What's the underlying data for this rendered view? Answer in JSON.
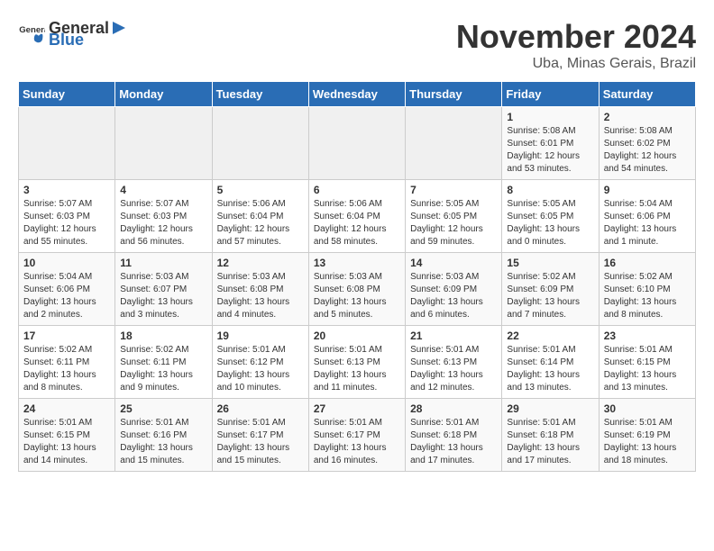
{
  "header": {
    "logo_general": "General",
    "logo_blue": "Blue",
    "month_title": "November 2024",
    "subtitle": "Uba, Minas Gerais, Brazil"
  },
  "weekdays": [
    "Sunday",
    "Monday",
    "Tuesday",
    "Wednesday",
    "Thursday",
    "Friday",
    "Saturday"
  ],
  "weeks": [
    [
      {
        "day": "",
        "info": ""
      },
      {
        "day": "",
        "info": ""
      },
      {
        "day": "",
        "info": ""
      },
      {
        "day": "",
        "info": ""
      },
      {
        "day": "",
        "info": ""
      },
      {
        "day": "1",
        "info": "Sunrise: 5:08 AM\nSunset: 6:01 PM\nDaylight: 12 hours and 53 minutes."
      },
      {
        "day": "2",
        "info": "Sunrise: 5:08 AM\nSunset: 6:02 PM\nDaylight: 12 hours and 54 minutes."
      }
    ],
    [
      {
        "day": "3",
        "info": "Sunrise: 5:07 AM\nSunset: 6:03 PM\nDaylight: 12 hours and 55 minutes."
      },
      {
        "day": "4",
        "info": "Sunrise: 5:07 AM\nSunset: 6:03 PM\nDaylight: 12 hours and 56 minutes."
      },
      {
        "day": "5",
        "info": "Sunrise: 5:06 AM\nSunset: 6:04 PM\nDaylight: 12 hours and 57 minutes."
      },
      {
        "day": "6",
        "info": "Sunrise: 5:06 AM\nSunset: 6:04 PM\nDaylight: 12 hours and 58 minutes."
      },
      {
        "day": "7",
        "info": "Sunrise: 5:05 AM\nSunset: 6:05 PM\nDaylight: 12 hours and 59 minutes."
      },
      {
        "day": "8",
        "info": "Sunrise: 5:05 AM\nSunset: 6:05 PM\nDaylight: 13 hours and 0 minutes."
      },
      {
        "day": "9",
        "info": "Sunrise: 5:04 AM\nSunset: 6:06 PM\nDaylight: 13 hours and 1 minute."
      }
    ],
    [
      {
        "day": "10",
        "info": "Sunrise: 5:04 AM\nSunset: 6:06 PM\nDaylight: 13 hours and 2 minutes."
      },
      {
        "day": "11",
        "info": "Sunrise: 5:03 AM\nSunset: 6:07 PM\nDaylight: 13 hours and 3 minutes."
      },
      {
        "day": "12",
        "info": "Sunrise: 5:03 AM\nSunset: 6:08 PM\nDaylight: 13 hours and 4 minutes."
      },
      {
        "day": "13",
        "info": "Sunrise: 5:03 AM\nSunset: 6:08 PM\nDaylight: 13 hours and 5 minutes."
      },
      {
        "day": "14",
        "info": "Sunrise: 5:03 AM\nSunset: 6:09 PM\nDaylight: 13 hours and 6 minutes."
      },
      {
        "day": "15",
        "info": "Sunrise: 5:02 AM\nSunset: 6:09 PM\nDaylight: 13 hours and 7 minutes."
      },
      {
        "day": "16",
        "info": "Sunrise: 5:02 AM\nSunset: 6:10 PM\nDaylight: 13 hours and 8 minutes."
      }
    ],
    [
      {
        "day": "17",
        "info": "Sunrise: 5:02 AM\nSunset: 6:11 PM\nDaylight: 13 hours and 8 minutes."
      },
      {
        "day": "18",
        "info": "Sunrise: 5:02 AM\nSunset: 6:11 PM\nDaylight: 13 hours and 9 minutes."
      },
      {
        "day": "19",
        "info": "Sunrise: 5:01 AM\nSunset: 6:12 PM\nDaylight: 13 hours and 10 minutes."
      },
      {
        "day": "20",
        "info": "Sunrise: 5:01 AM\nSunset: 6:13 PM\nDaylight: 13 hours and 11 minutes."
      },
      {
        "day": "21",
        "info": "Sunrise: 5:01 AM\nSunset: 6:13 PM\nDaylight: 13 hours and 12 minutes."
      },
      {
        "day": "22",
        "info": "Sunrise: 5:01 AM\nSunset: 6:14 PM\nDaylight: 13 hours and 13 minutes."
      },
      {
        "day": "23",
        "info": "Sunrise: 5:01 AM\nSunset: 6:15 PM\nDaylight: 13 hours and 13 minutes."
      }
    ],
    [
      {
        "day": "24",
        "info": "Sunrise: 5:01 AM\nSunset: 6:15 PM\nDaylight: 13 hours and 14 minutes."
      },
      {
        "day": "25",
        "info": "Sunrise: 5:01 AM\nSunset: 6:16 PM\nDaylight: 13 hours and 15 minutes."
      },
      {
        "day": "26",
        "info": "Sunrise: 5:01 AM\nSunset: 6:17 PM\nDaylight: 13 hours and 15 minutes."
      },
      {
        "day": "27",
        "info": "Sunrise: 5:01 AM\nSunset: 6:17 PM\nDaylight: 13 hours and 16 minutes."
      },
      {
        "day": "28",
        "info": "Sunrise: 5:01 AM\nSunset: 6:18 PM\nDaylight: 13 hours and 17 minutes."
      },
      {
        "day": "29",
        "info": "Sunrise: 5:01 AM\nSunset: 6:18 PM\nDaylight: 13 hours and 17 minutes."
      },
      {
        "day": "30",
        "info": "Sunrise: 5:01 AM\nSunset: 6:19 PM\nDaylight: 13 hours and 18 minutes."
      }
    ]
  ]
}
